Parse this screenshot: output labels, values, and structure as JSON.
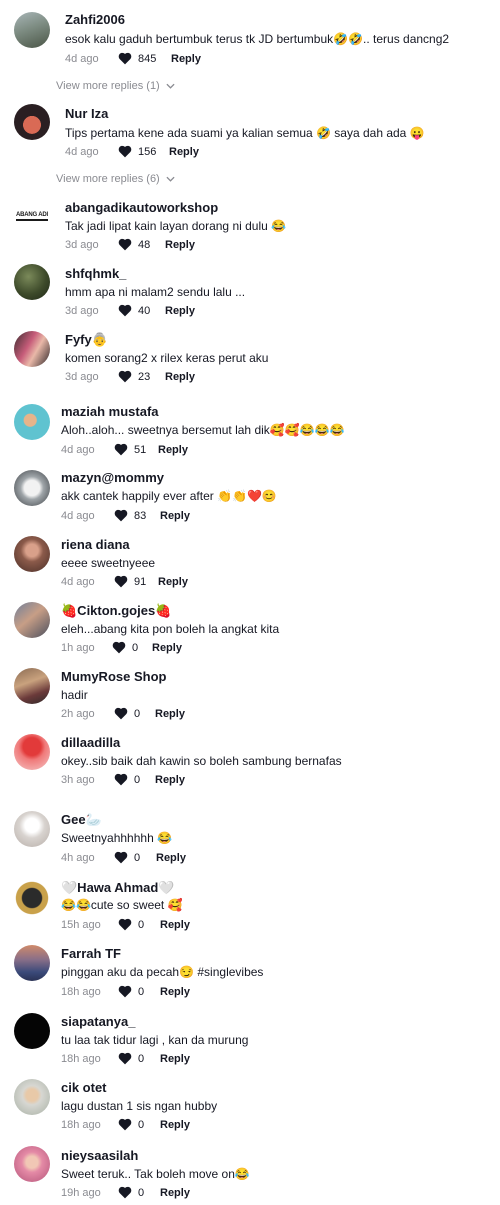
{
  "comments": [
    {
      "username": "Zahfi2006",
      "text": "esok kalu gaduh bertumbuk terus tk JD bertumbuk🤣🤣.. terus dancng2",
      "time": "4d ago",
      "likes": "845",
      "reply": "Reply",
      "view_more": "View more replies (1)"
    },
    {
      "username": "Nur Iza",
      "text": "Tips pertama kene ada suami ya kalian semua 🤣 saya dah ada 😛",
      "time": "4d ago",
      "likes": "156",
      "reply": "Reply",
      "view_more": "View more replies (6)"
    },
    {
      "username": "abangadikautoworkshop",
      "text": "Tak jadi lipat kain layan dorang ni dulu 😂",
      "time": "3d ago",
      "likes": "48",
      "reply": "Reply"
    },
    {
      "username": "shfqhmk_",
      "text": "hmm apa ni malam2 sendu lalu ...",
      "time": "3d ago",
      "likes": "40",
      "reply": "Reply"
    },
    {
      "username": "Fyfy👵",
      "text": "komen sorang2 x rilex keras perut aku",
      "time": "3d ago",
      "likes": "23",
      "reply": "Reply"
    },
    {
      "username": "maziah mustafa",
      "text": "Aloh..aloh... sweetnya bersemut lah dik🥰🥰😂😂😂",
      "time": "4d ago",
      "likes": "51",
      "reply": "Reply"
    },
    {
      "username": "mazyn@mommy",
      "text": "akk cantek happily ever after 👏👏❤️😊",
      "time": "4d ago",
      "likes": "83",
      "reply": "Reply"
    },
    {
      "username": "riena diana",
      "text": "eeee sweetnyeee",
      "time": "4d ago",
      "likes": "91",
      "reply": "Reply"
    },
    {
      "username": "🍓Cikton.gojes🍓",
      "text": "eleh...abang kita pon boleh la angkat kita",
      "time": "1h ago",
      "likes": "0",
      "reply": "Reply"
    },
    {
      "username": "MumyRose Shop",
      "text": "hadir",
      "time": "2h ago",
      "likes": "0",
      "reply": "Reply"
    },
    {
      "username": "dillaadilla",
      "text": "okey..sib baik dah kawin so boleh sambung bernafas",
      "time": "3h ago",
      "likes": "0",
      "reply": "Reply"
    },
    {
      "username": "Gee🦢",
      "text": "Sweetnyahhhhhh 😂",
      "time": "4h ago",
      "likes": "0",
      "reply": "Reply"
    },
    {
      "username": "🤍Hawa Ahmad🤍",
      "text": "😂😂cute so sweet 🥰",
      "time": "15h ago",
      "likes": "0",
      "reply": "Reply"
    },
    {
      "username": "Farrah TF",
      "text": "pinggan aku da pecah😏 #singlevibes",
      "time": "18h ago",
      "likes": "0",
      "reply": "Reply"
    },
    {
      "username": "siapatanya_",
      "text": "tu laa tak tidur lagi , kan da murung",
      "time": "18h ago",
      "likes": "0",
      "reply": "Reply"
    },
    {
      "username": "cik otet",
      "text": "lagu dustan 1 sis ngan hubby",
      "time": "18h ago",
      "likes": "0",
      "reply": "Reply"
    },
    {
      "username": "nieysaasilah",
      "text": "Sweet teruk.. Tak boleh move on😂",
      "time": "19h ago",
      "likes": "0",
      "reply": "Reply"
    }
  ],
  "avatar_logo_text": "ABANG ADI",
  "colors": {
    "text": "#161823",
    "muted": "#8a8b91",
    "background": "#ffffff"
  }
}
